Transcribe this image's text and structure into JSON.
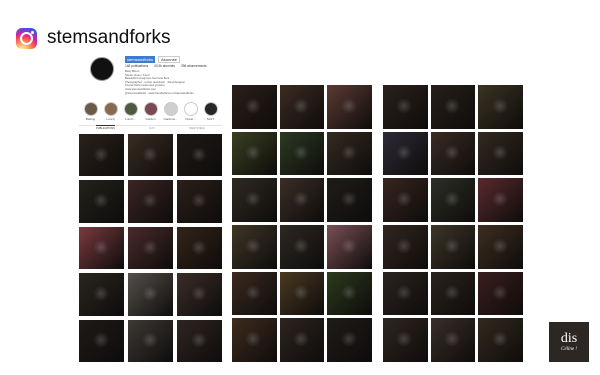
{
  "header": {
    "handle": "stemsandforks",
    "icon": "instagram-icon"
  },
  "profile": {
    "username": "stemsandforks",
    "button_label": "Abonnée",
    "stats": [
      "148 publications",
      "40,9k abonnés",
      "396 abonnements"
    ],
    "bio": [
      "Betty Binon",
      "Studio photo / Food",
      "Beautiful homegrown food and flora",
      "Photographer · recipe developer · floral designer",
      "Friend.chefs.cooks.and.growers",
      "www.stemsandforks.com",
      "@stemsandforks · www.friendlyfaces.co/stemsandforks"
    ],
    "highlights": [
      "Baking",
      "Lunch",
      "Lunch...",
      "Garden",
      "Gardens...",
      "Floral...",
      "SALT"
    ],
    "tabs": [
      "PUBLICATIONS",
      "IGTV",
      "IDENTIFIÉ(E)"
    ]
  },
  "grid_colors": {
    "col1": [
      "#2b211a",
      "#3a2c22",
      "#1f1a17",
      "#24221c",
      "#3b2423",
      "#2a1f19",
      "#7a3a3f",
      "#4a2a2c",
      "#342418",
      "#2a2620",
      "#55504a",
      "#3b2d29",
      "#1e1a18",
      "#3d3935",
      "#2f2521"
    ],
    "col2": [
      "#2c1f1a",
      "#3b2c22",
      "#5b3a33",
      "#3a4122",
      "#2c3b22",
      "#352b20",
      "#2f2a22",
      "#3a2e26",
      "#1f1c18",
      "#3f3726",
      "#2e2822",
      "#7a4f55",
      "#3b2a1f",
      "#4a3922",
      "#2b3a1c",
      "#3f2c1e",
      "#2d2520",
      "#1f1b18"
    ],
    "col3": [
      "#2a211b",
      "#272018",
      "#3b3322",
      "#2e2a38",
      "#3a2b24",
      "#332a21",
      "#37251f",
      "#2d2f26",
      "#5a2a2d",
      "#33261f",
      "#3e3528",
      "#3e2e20",
      "#2b2420",
      "#2a231d",
      "#3a1e1c",
      "#2f2620",
      "#3a2e2a",
      "#322a1e"
    ]
  },
  "logo": {
    "main": "dis",
    "sub": "Céline !"
  }
}
